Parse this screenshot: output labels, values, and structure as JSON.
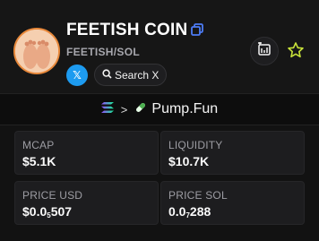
{
  "token": {
    "name": "FEETISH COIN",
    "pair": "FEETISH/SOL",
    "x_label": "𝕏",
    "search_x_label": "Search X"
  },
  "dex": {
    "name": "Pump.Fun"
  },
  "stats": {
    "mcap": {
      "label": "MCAP",
      "value": "$5.1K"
    },
    "liquidity": {
      "label": "LIQUIDITY",
      "value": "$10.7K"
    },
    "price_usd": {
      "label": "PRICE USD",
      "prefix": "$0.0",
      "zeros": "5",
      "suffix": "507"
    },
    "price_sol": {
      "label": "PRICE SOL",
      "prefix": "0.0",
      "zeros": "7",
      "suffix": "288"
    }
  },
  "colors": {
    "accent_blue": "#4d7cf6",
    "x_blue": "#1d9bf0",
    "star": "#c8e23a",
    "solana_gradient": [
      "#9945ff",
      "#14f195"
    ]
  },
  "icons": [
    "copy-icon",
    "x-logo-icon",
    "search-icon",
    "add-to-list-icon",
    "star-icon",
    "solana-icon",
    "chevron-right-icon",
    "pill-icon"
  ]
}
